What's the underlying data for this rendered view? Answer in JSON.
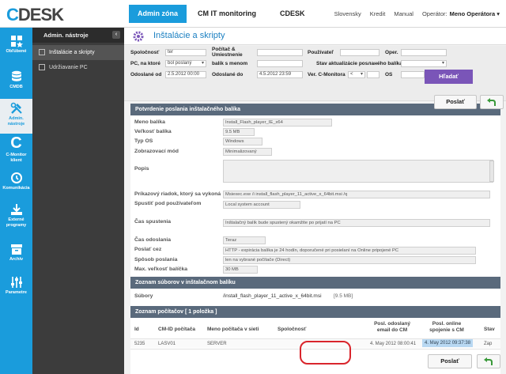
{
  "app": {
    "logo_prefix": "C",
    "logo_rest": "DESK"
  },
  "topnav": {
    "items": [
      "Admin zóna",
      "CM IT monitoring",
      "CDESK"
    ]
  },
  "toplinks": {
    "lang": "Slovensky",
    "credit": "Kredit",
    "manual": "Manual",
    "operator_label": "Operátor:",
    "operator_name": "Meno Operátora ▾"
  },
  "leftbar": {
    "items": [
      "Obľúbené",
      "CMDB",
      "Admin. nástroje",
      "C-Monitor klient",
      "Komunikácia",
      "Externé programy",
      "Archív",
      "Parametre"
    ]
  },
  "sidebar": {
    "title": "Admin. nástroje",
    "collapse": "‹",
    "items": [
      "Inštalácie a skripty",
      "Udržiavanie PC"
    ]
  },
  "page": {
    "title": "Inštalácie a skripty"
  },
  "filter": {
    "spolocnost_label": "Spoločnosť",
    "spolocnost_value": "ter",
    "pocitac_label": "Počítač & Umiestnenie",
    "pouzivatel_label": "Používateľ",
    "oper_label": "Oper.",
    "pc_label": "PC, na ktoré",
    "pc_value": "bol poslaný",
    "balik_label": "balík s menom",
    "stav_label": "Stav aktualizácie posланého balíka je",
    "odoslane_od_label": "Odoslané od",
    "odoslane_od_value": "2.5.2012 00:00",
    "odoslane_do_label": "Odoslané do",
    "odoslane_do_value": "4.5.2012 23:59",
    "ver_label": "Ver. C-Monitora",
    "ver_op": "<",
    "os_label": "OS",
    "search_button": "Hľadať"
  },
  "confirm": {
    "title": "Potvrdenie poslania inštalačného balíka",
    "send_button": "Poslať"
  },
  "details": {
    "meno_label": "Meno balíka",
    "meno_value": "Install_Flash_player_IE_x64",
    "velkost_label": "Veľkosť balíka",
    "velkost_value": "9.5 MB",
    "typ_label": "Typ OS",
    "typ_value": "Windows",
    "mod_label": "Zobrazovací mód",
    "mod_value": "Minimalizovaný",
    "popis_label": "Popis",
    "prikaz_label": "Príkazový riadok, ktorý sa vykoná",
    "prikaz_value": "Msiexec.exe /i install_flash_player_11_active_x_64bit.msi /q",
    "spustit_label": "Spustiť pod používateľom",
    "spustit_value": "Local system account",
    "cas_spustenia_label": "Čas spustenia",
    "cas_spustenia_value": "Inštalačný balík bude spustený okamžite po prijatí na PC",
    "cas_odoslania_label": "Čas odoslania",
    "cas_odoslania_value": "Teraz",
    "poslat_cez_label": "Poslať cez",
    "poslat_cez_value": "HTTP  -  expirácia balíka je 24 hodín, doporučené pri posielaní na Online pripojené PC",
    "sposob_label": "Spôsob poslania",
    "sposob_value": "len na vybrané počítače (Direct)",
    "max_label": "Max. veľkosť balíčka",
    "max_value": "30 MB"
  },
  "files": {
    "title": "Zoznam súborov v inštalačnom balíku",
    "label": "Súbory",
    "name": "/install_flash_player_11_active_x_64bit.msi",
    "size": "[9.5 MB]"
  },
  "computers": {
    "title": "Zoznam počítačov [ 1 položka ]",
    "headers": [
      "Id",
      "CM-ID počítača",
      "Meno počítača v sieti",
      "Spoločnosť",
      "Posl. odoslaný email do CM",
      "Posl. online spojenie s CM",
      "Stav"
    ],
    "rows": [
      [
        "5235",
        "LASV01",
        "SERVER",
        "",
        "4. May 2012 08:00:41",
        "4. May 2012 09:37:38",
        "Zap"
      ]
    ]
  },
  "bottom": {
    "send_button": "Poslať"
  },
  "colors": {
    "accent": "#1a9cdc",
    "section": "#5a6a7c",
    "search": "#7a55b8",
    "highlight": "#d9252c"
  }
}
